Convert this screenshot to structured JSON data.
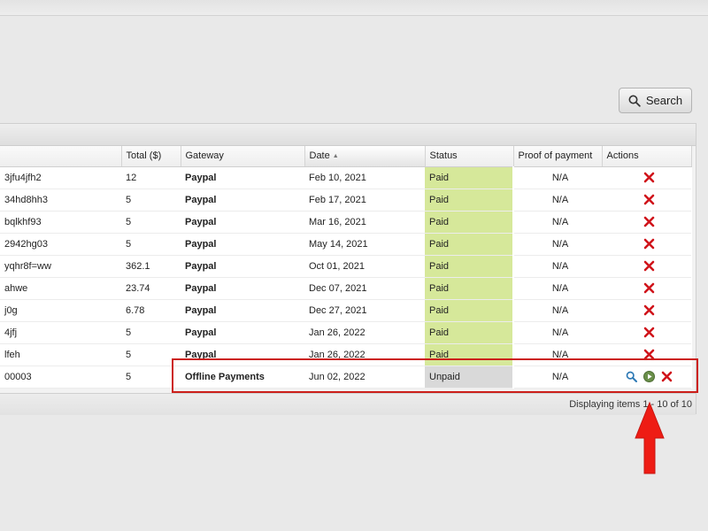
{
  "search": {
    "label": "Search"
  },
  "table": {
    "columns": {
      "reference": "",
      "total": "Total ($)",
      "gateway": "Gateway",
      "date": "Date",
      "status": "Status",
      "proof": "Proof of payment",
      "actions": "Actions"
    },
    "sorted_column": "date",
    "sort_direction": "ascending",
    "rows": [
      {
        "ref": "3jfu4jfh2",
        "total": "12",
        "gateway": "Paypal",
        "date": "Feb 10, 2021",
        "status": "Paid",
        "proof": "N/A",
        "actions": [
          "delete-icon"
        ]
      },
      {
        "ref": "34hd8hh3",
        "total": "5",
        "gateway": "Paypal",
        "date": "Feb 17, 2021",
        "status": "Paid",
        "proof": "N/A",
        "actions": [
          "delete-icon"
        ]
      },
      {
        "ref": "bqlkhf93",
        "total": "5",
        "gateway": "Paypal",
        "date": "Mar 16, 2021",
        "status": "Paid",
        "proof": "N/A",
        "actions": [
          "delete-icon"
        ]
      },
      {
        "ref": "2942hg03",
        "total": "5",
        "gateway": "Paypal",
        "date": "May 14, 2021",
        "status": "Paid",
        "proof": "N/A",
        "actions": [
          "delete-icon"
        ]
      },
      {
        "ref": "yqhr8f=ww",
        "total": "362.1",
        "gateway": "Paypal",
        "date": "Oct 01, 2021",
        "status": "Paid",
        "proof": "N/A",
        "actions": [
          "delete-icon"
        ]
      },
      {
        "ref": "ahwe",
        "total": "23.74",
        "gateway": "Paypal",
        "date": "Dec 07, 2021",
        "status": "Paid",
        "proof": "N/A",
        "actions": [
          "delete-icon"
        ]
      },
      {
        "ref": "j0g",
        "total": "6.78",
        "gateway": "Paypal",
        "date": "Dec 27, 2021",
        "status": "Paid",
        "proof": "N/A",
        "actions": [
          "delete-icon"
        ]
      },
      {
        "ref": "4jfj",
        "total": "5",
        "gateway": "Paypal",
        "date": "Jan 26, 2022",
        "status": "Paid",
        "proof": "N/A",
        "actions": [
          "delete-icon"
        ]
      },
      {
        "ref": "lfeh",
        "total": "5",
        "gateway": "Paypal",
        "date": "Jan 26, 2022",
        "status": "Paid",
        "proof": "N/A",
        "actions": [
          "delete-icon"
        ]
      },
      {
        "ref": "00003",
        "total": "5",
        "gateway": "Offline Payments",
        "date": "Jun 02, 2022",
        "status": "Unpaid",
        "proof": "N/A",
        "actions": [
          "search-icon",
          "play-icon",
          "delete-icon"
        ]
      }
    ]
  },
  "paging": {
    "text": "Displaying items 1 - 10 of 10"
  },
  "colors": {
    "paid_status": "#d6e89a",
    "unpaid_status": "#d9d9d9",
    "delete": "#d0141b",
    "annotation": "#cc1f1a"
  }
}
